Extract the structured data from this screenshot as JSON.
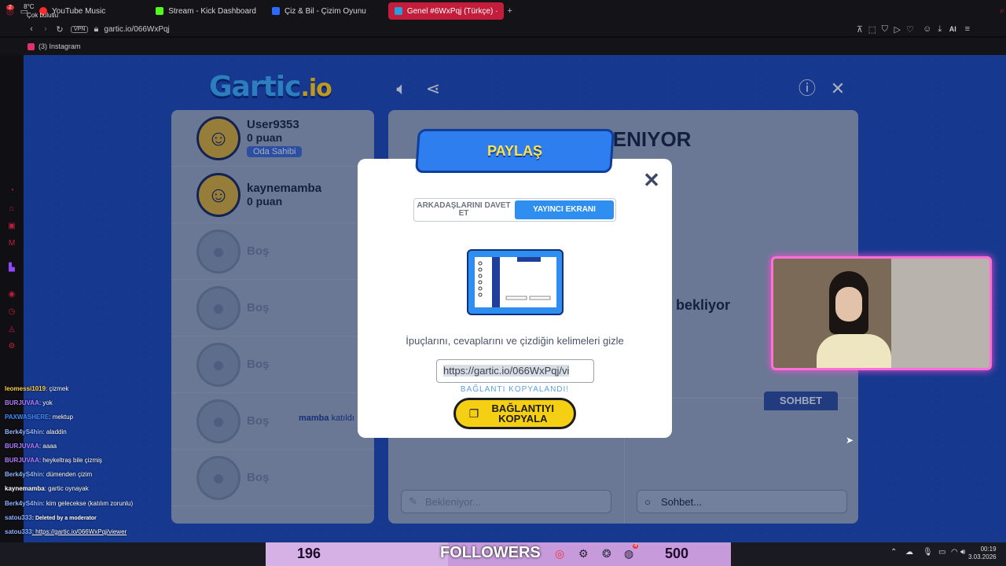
{
  "browser": {
    "tabs": [
      {
        "label": "YouTube Music",
        "color": "#ff2a2a"
      },
      {
        "label": "Stream - Kick Dashboard",
        "color": "#53fc18"
      },
      {
        "label": "Çiz & Bil - Çizim Oyunu",
        "color": "#2b6cff"
      },
      {
        "label": "Genel #6WxPqj (Türkçe) ·",
        "color": "#2d9cdb"
      }
    ],
    "vpn_label": "VPN",
    "url": "gartic.io/066WxPqj",
    "bookmark": "(3) Instagram",
    "ai_label": "AI"
  },
  "game": {
    "logo": "Gartic",
    "logo_suffix": ".io",
    "players": [
      {
        "name": "User9353",
        "score": "0 puan",
        "badge": "Oda Sahibi"
      },
      {
        "name": "kaynemamba",
        "score": "0 puan"
      }
    ],
    "empty_slots": [
      "Boş",
      "Boş",
      "Boş",
      "Boş",
      "Boş"
    ],
    "waiting_title": "BEKLENIYOR",
    "waiting_sub": "n bekliyor",
    "answer_placeholder": "Bekleniyor...",
    "chat_tab": "SOHBET",
    "chat_placeholder": "Sohbet...",
    "joined_user": "mamba",
    "joined_text": "katıldı"
  },
  "modal": {
    "title": "PAYLAŞ",
    "tab_invite": "ARKADAŞLARINI DAVET ET",
    "tab_streamer": "YAYINCI EKRANI",
    "hide_text": "İpuçlarını, cevaplarını ve çizdiğin kelimeleri gizle",
    "url": "https://gartic.io/066WxPqj/vi",
    "copied": "BAĞLANTI KOPYALANDI!",
    "copy_button": "BAĞLANTIYI KOPYALA"
  },
  "chat": [
    {
      "user": "leomessi1019",
      "text": ": çizmek",
      "color": "#ffcf3a"
    },
    {
      "user": "BURJUVAA",
      "text": ": yok",
      "color": "#b07cff"
    },
    {
      "user": "PAXWASHERE",
      "text": ": mektup",
      "color": "#3f8cff"
    },
    {
      "user": "Berk4yS4hin",
      "text": ": aladdin",
      "color": "#8fb4ff"
    },
    {
      "user": "BURJUVAA",
      "text": ": aaaa",
      "color": "#b07cff"
    },
    {
      "user": "BURJUVAA",
      "text": ": heykeltraş bile çizmiş",
      "color": "#b07cff"
    },
    {
      "user": "Berk4yS4hin",
      "text": ": dümenden çizim",
      "color": "#8fb4ff"
    },
    {
      "user": "kaynemamba",
      "text": ": gartic oynayak",
      "color": "#ffffff"
    },
    {
      "user": "Berk4yS4hin",
      "text": ": kim gelecekse (katılım zorunlu)",
      "color": "#8fb4ff"
    },
    {
      "user": "satou333",
      "text": ": Deleted by a moderator",
      "color": "#8fb4ff"
    },
    {
      "user": "satou333",
      "text": ": https://gartic.io/066WxPqj/viewer",
      "color": "#8fb4ff"
    }
  ],
  "taskbar": {
    "weather_badge": "2",
    "temp": "8°C",
    "condition": "Çok bulutlu",
    "followers_current": "196",
    "followers_title": "FOLLOWERS",
    "followers_goal": "500",
    "notif_badge": "4",
    "time": "00:19",
    "date": "3.03.2026"
  }
}
